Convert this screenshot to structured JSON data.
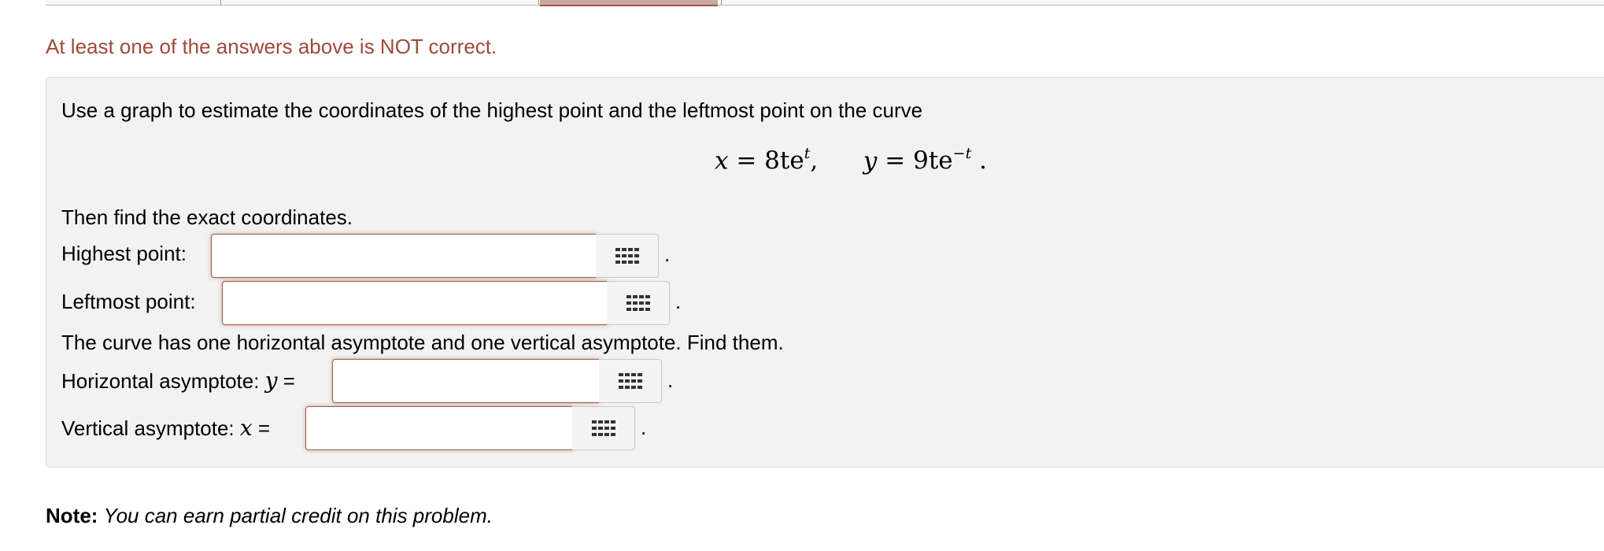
{
  "status_message": "At least one of the answers above is NOT correct.",
  "problem": {
    "prompt": "Use a graph to estimate the coordinates of the highest point and the leftmost point on the curve",
    "equation": {
      "x_lhs": "x",
      "eq1": "= 8te",
      "x_exp": "t",
      "comma": ",",
      "y_lhs": "y",
      "eq2": "= 9te",
      "y_exp": "−t",
      "period": "."
    },
    "instruction": "Then find the exact coordinates.",
    "asymptote_prompt": "The curve has one horizontal asymptote and one vertical asymptote. Find them.",
    "fields": [
      {
        "label": "Highest point:",
        "value": "",
        "icon": "keypad-icon",
        "suffix": "."
      },
      {
        "label": "Leftmost point:",
        "value": "",
        "icon": "keypad-icon",
        "suffix": "."
      },
      {
        "label": "Horizontal asymptote:",
        "var": "y",
        "eq": "=",
        "value": "",
        "icon": "keypad-icon",
        "suffix": "."
      },
      {
        "label": "Vertical asymptote:",
        "var": "x",
        "eq": "=",
        "value": "",
        "icon": "keypad-icon",
        "suffix": "."
      }
    ]
  },
  "note": {
    "bold": "Note:",
    "text": "You can earn partial credit on this problem."
  },
  "colors": {
    "error": "#9e4a3a",
    "panel": "#f2f2f2",
    "input_border": "#9e5a46"
  }
}
